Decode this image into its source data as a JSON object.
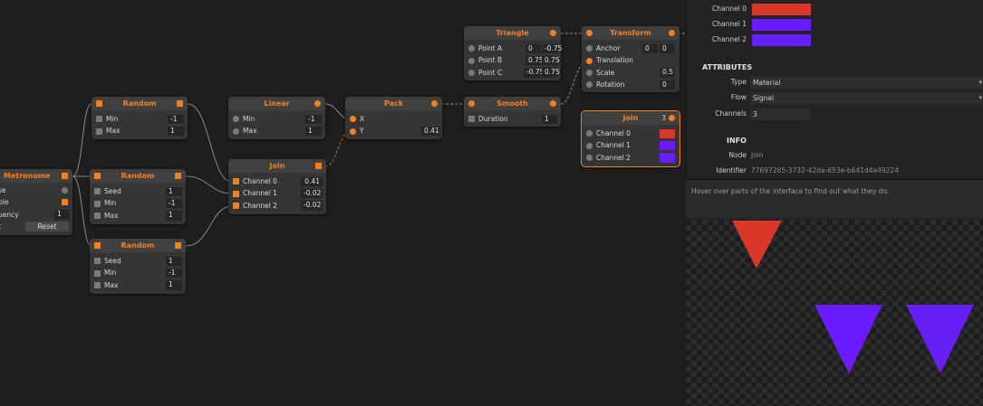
{
  "colors": {
    "accent": "#f5801f",
    "red": "#d8372a",
    "purple": "#6a1cff",
    "purple2": "#6420f5"
  },
  "nodes": {
    "metronome": {
      "title": "Metronome",
      "rows": [
        "se",
        "ble",
        "uency",
        "t"
      ],
      "frequency": "1",
      "reset": "Reset"
    },
    "random1": {
      "title": "Random",
      "min": "Min",
      "min_v": "-1",
      "max": "Max",
      "max_v": "1"
    },
    "random2": {
      "title": "Random",
      "seed": "Seed",
      "seed_v": "1",
      "min": "Min",
      "min_v": "-1",
      "max": "Max",
      "max_v": "1"
    },
    "random3": {
      "title": "Random",
      "seed": "Seed",
      "seed_v": "1",
      "min": "Min",
      "min_v": "-1",
      "max": "Max",
      "max_v": "1"
    },
    "linear": {
      "title": "Linear",
      "min": "Min",
      "min_v": "-1",
      "max": "Max",
      "max_v": "1"
    },
    "join_a": {
      "title": "Join",
      "c0": "Channel 0",
      "c0_v": "0.41",
      "c1": "Channel 1",
      "c1_v": "-0.02",
      "c2": "Channel 2",
      "c2_v": "-0.02"
    },
    "pack": {
      "title": "Pack",
      "x": "X",
      "y": "Y",
      "y_v": "0.41"
    },
    "smooth": {
      "title": "Smooth",
      "duration": "Duration",
      "duration_v": "1"
    },
    "triangle": {
      "title": "Triangle",
      "a": "Point A",
      "a_x": "0",
      "a_y": "-0.75",
      "b": "Point B",
      "b_x": "0.75",
      "b_y": "0.75",
      "c": "Point C",
      "c_x": "-0.75",
      "c_y": "0.75"
    },
    "transform": {
      "title": "Transform",
      "anchor": "Anchor",
      "anchor_x": "0",
      "anchor_y": "0",
      "translation": "Translation",
      "scale": "Scale",
      "scale_v": "0.5",
      "rotation": "Rotation",
      "rotation_v": "0"
    },
    "join_b": {
      "title": "Join",
      "count": "3",
      "c0": "Channel 0",
      "c1": "Channel 1",
      "c2": "Channel 2"
    }
  },
  "panel": {
    "channels": [
      {
        "label": "Channel 0",
        "color": "#d8372a"
      },
      {
        "label": "Channel 1",
        "color": "#6a1cff"
      },
      {
        "label": "Channel 2",
        "color": "#6420f5"
      }
    ],
    "attributes_title": "ATTRIBUTES",
    "type_label": "Type",
    "type_value": "Material",
    "flow_label": "Flow",
    "flow_value": "Signal",
    "channels_label": "Channels",
    "channels_value": "3",
    "info_title": "INFO",
    "node_label": "Node",
    "node_value": "Join",
    "identifier_label": "Identifier",
    "identifier_value": "77697265-3732-42da-653e-b641d4a49224"
  },
  "help_text": "Hover over parts of the interface to find out what they do."
}
